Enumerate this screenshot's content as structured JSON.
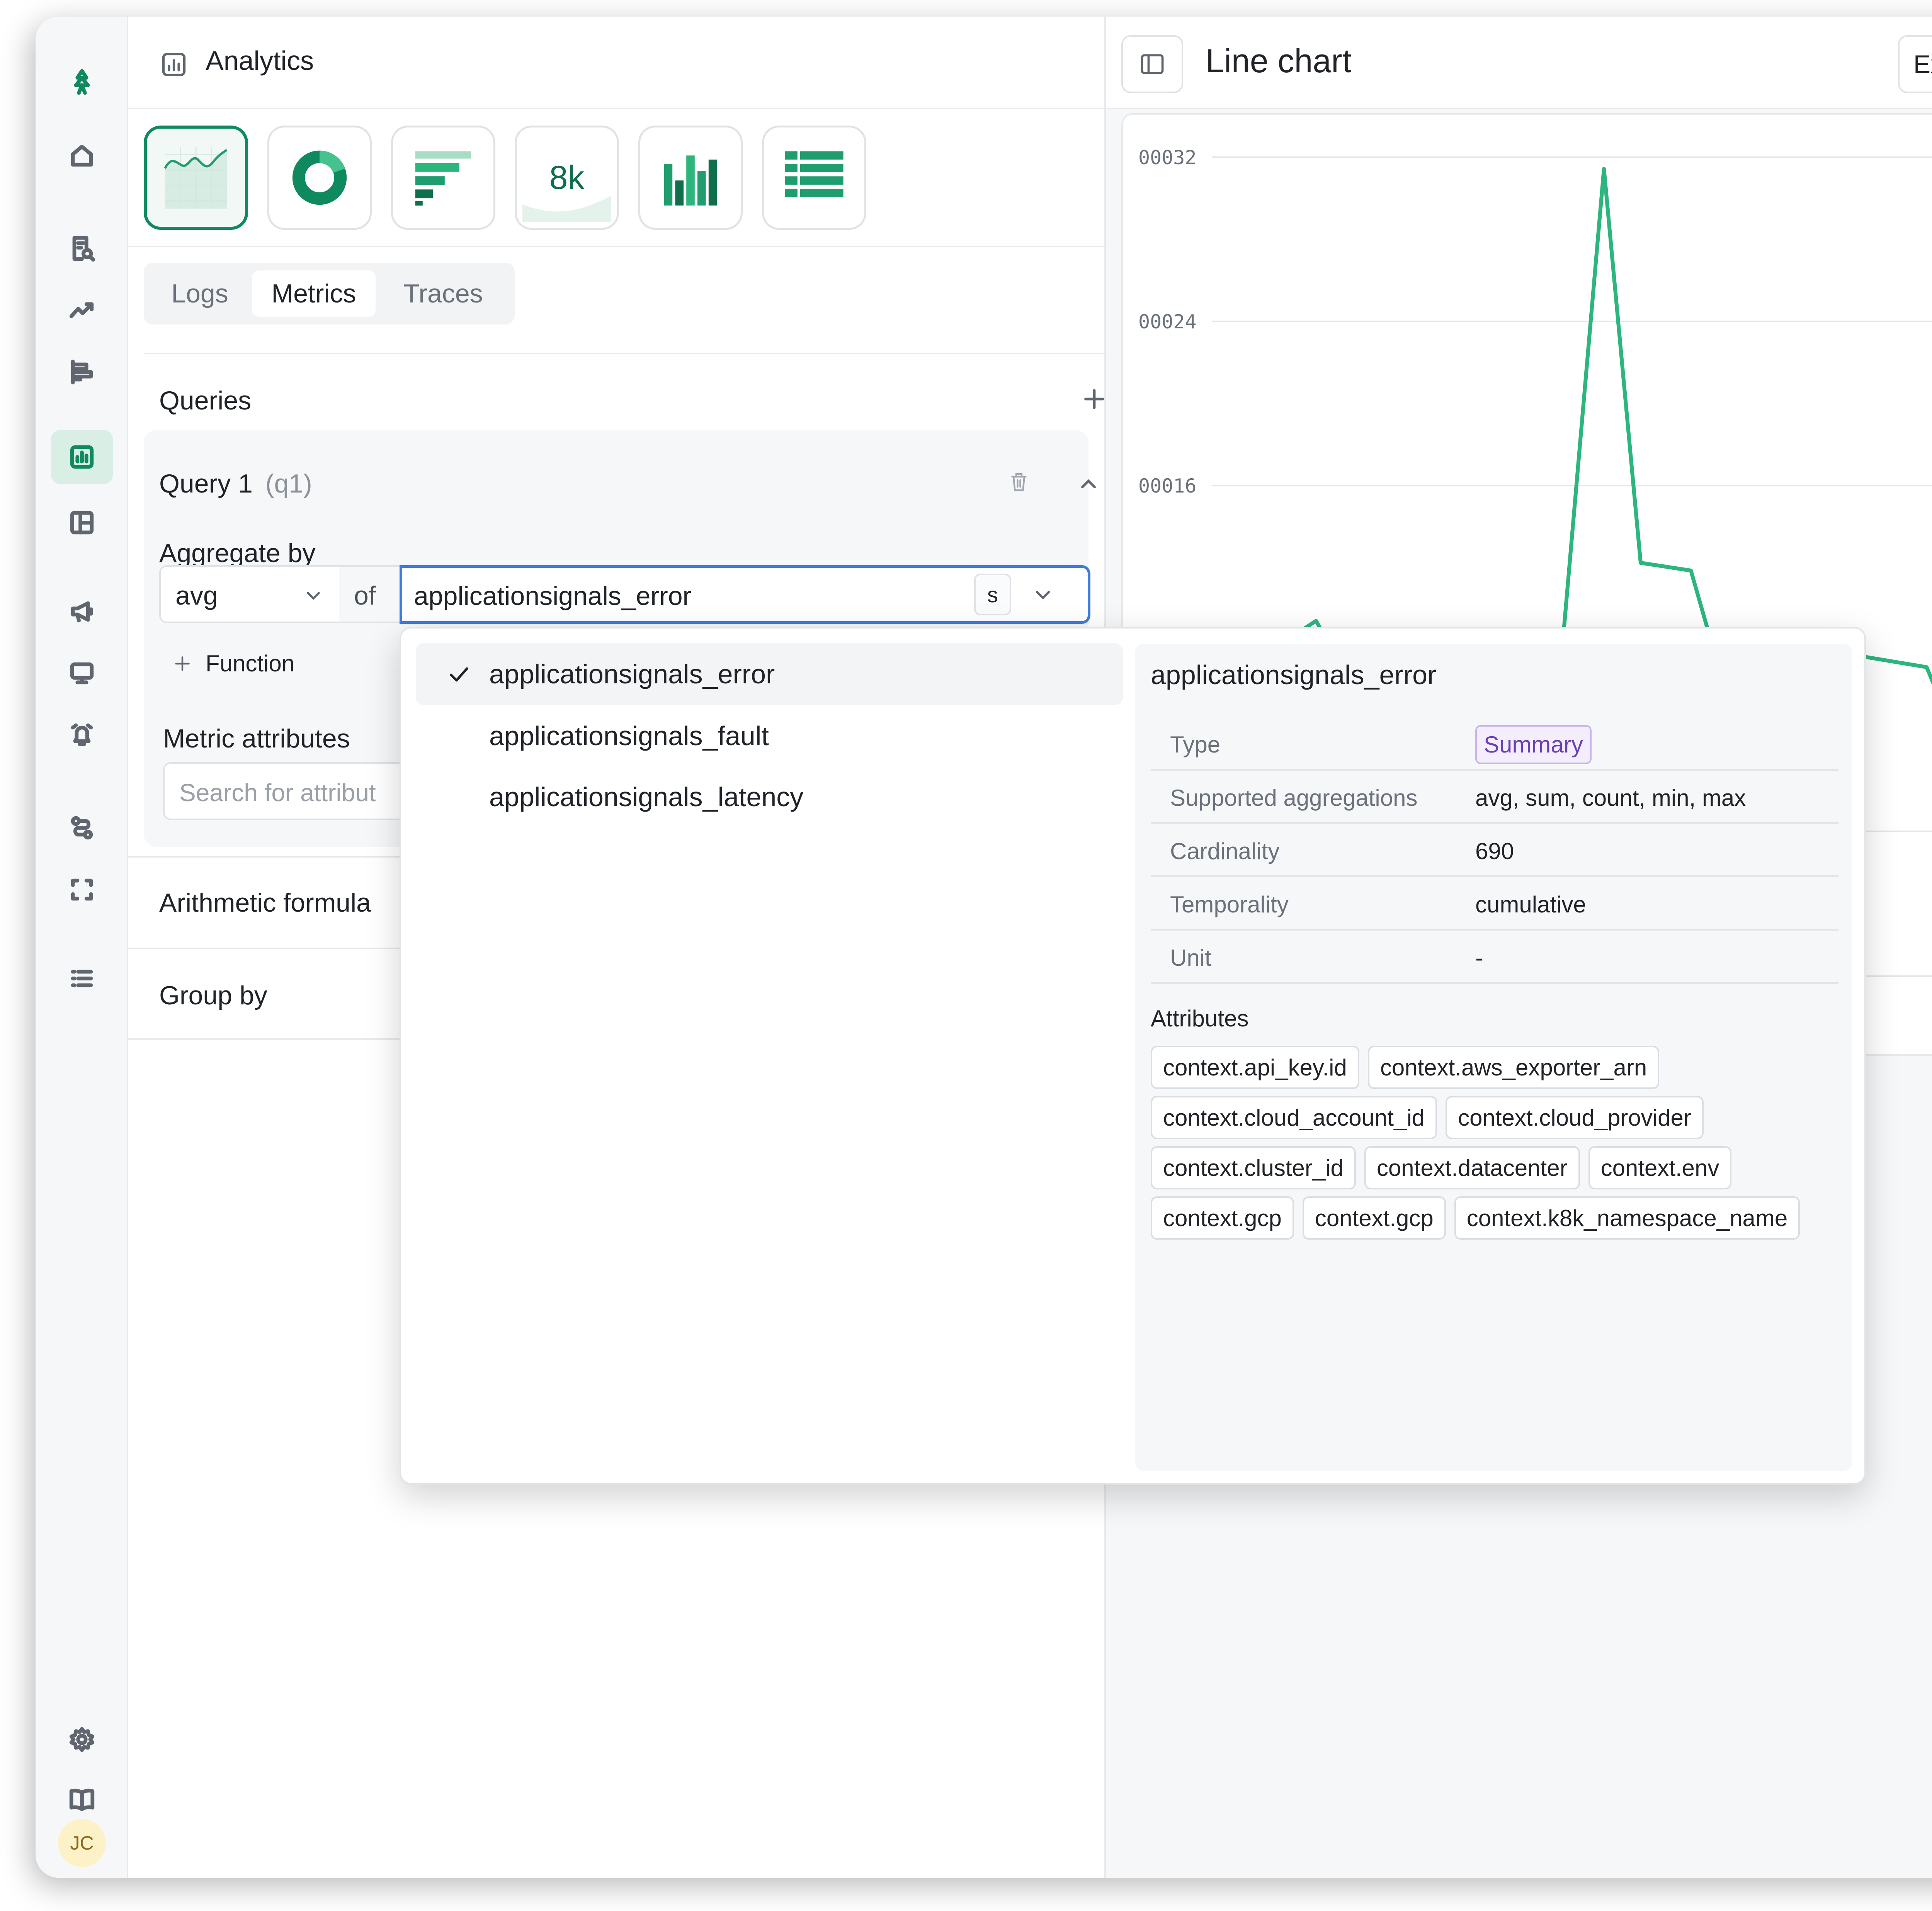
{
  "header": {
    "title": "Analytics"
  },
  "viz_types": [
    {
      "name": "line",
      "selected": true
    },
    {
      "name": "donut",
      "selected": false
    },
    {
      "name": "bar-horizontal",
      "selected": false
    },
    {
      "name": "stat",
      "label": "8k",
      "selected": false
    },
    {
      "name": "bar-vertical",
      "selected": false
    },
    {
      "name": "table",
      "selected": false
    }
  ],
  "tabs": [
    {
      "label": "Logs",
      "active": false
    },
    {
      "label": "Metrics",
      "active": true
    },
    {
      "label": "Traces",
      "active": false
    }
  ],
  "queries": {
    "title": "Queries",
    "query": {
      "title": "Query 1",
      "alias": "(q1)"
    },
    "aggregate_label": "Aggregate by",
    "aggregate_value": "avg",
    "of_label": "of",
    "metric_value": "applicationsignals_error",
    "metric_type_badge": "s",
    "function_button": "Function",
    "metric_attributes_label": "Metric attributes",
    "attribute_search_placeholder": "Search for attribut",
    "arithmetic_label": "Arithmetic formula",
    "group_by_label": "Group by"
  },
  "chart_panel": {
    "title": "Line chart",
    "export_label": "Expo"
  },
  "chart_data": {
    "type": "line",
    "y_tick_labels": [
      "00032",
      "00024",
      "00016"
    ],
    "grid": true,
    "series_color": "#2cb67d",
    "notes": "Partially visible line chart; values estimated from gridlines (y in thousandths-scale units 0-32)."
  },
  "dropdown": {
    "options": [
      {
        "label": "applicationsignals_error",
        "selected": true
      },
      {
        "label": "applicationsignals_fault",
        "selected": false
      },
      {
        "label": "applicationsignals_latency",
        "selected": false
      }
    ],
    "detail": {
      "title": "applicationsignals_error",
      "rows": [
        {
          "key": "Type",
          "value": "Summary",
          "badge": true
        },
        {
          "key": "Supported aggregations",
          "value": "avg, sum, count, min, max"
        },
        {
          "key": "Cardinality",
          "value": "690"
        },
        {
          "key": "Temporality",
          "value": "cumulative"
        },
        {
          "key": "Unit",
          "value": "-"
        }
      ],
      "attributes_label": "Attributes",
      "attributes": [
        "context.api_key.id",
        "context.aws_exporter_arn",
        "context.cloud_account_id",
        "context.cloud_provider",
        "context.cluster_id",
        "context.datacenter",
        "context.env",
        "context.gcp",
        "context.gcp",
        "context.k8k_namespace_name"
      ]
    }
  },
  "user": {
    "initials": "JC"
  },
  "colors": {
    "accent": "#0f8a5f",
    "focus": "#3f7be0",
    "badge_purple": "#6b3fb5"
  }
}
